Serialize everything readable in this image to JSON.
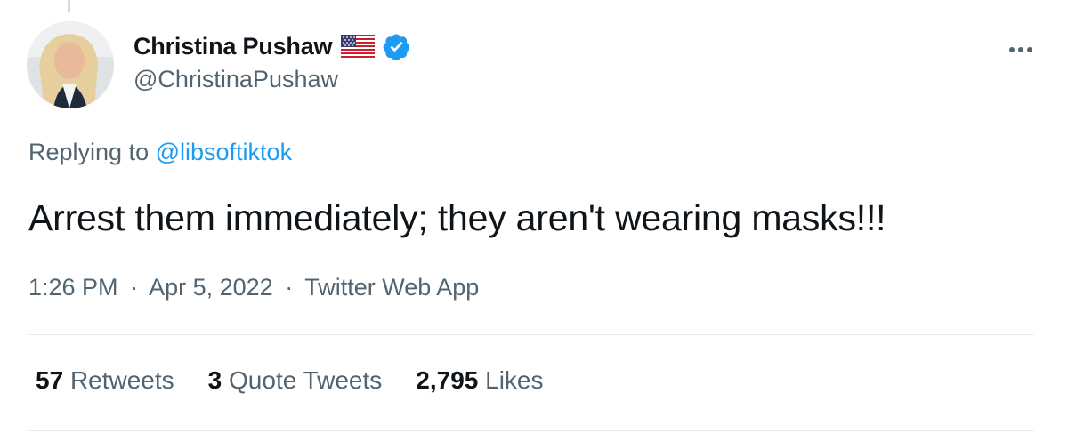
{
  "author": {
    "display_name": "Christina Pushaw",
    "handle": "@ChristinaPushaw",
    "flag_icon": "us-flag-icon",
    "verified_icon": "verified-badge-icon",
    "verified_color": "#1d9bf0"
  },
  "reply": {
    "prefix": "Replying to",
    "mention": "@libsoftiktok"
  },
  "tweet": {
    "text": "Arrest them immediately; they aren't wearing masks!!!"
  },
  "meta": {
    "time": "1:26 PM",
    "date": "Apr 5, 2022",
    "source": "Twitter Web App",
    "separator": "·"
  },
  "stats": {
    "retweets_count": "57",
    "retweets_label": "Retweets",
    "quotes_count": "3",
    "quotes_label": "Quote Tweets",
    "likes_count": "2,795",
    "likes_label": "Likes"
  },
  "colors": {
    "text_primary": "#0f1419",
    "text_secondary": "#536471",
    "link": "#1d9bf0",
    "divider": "#e6ecf0"
  }
}
